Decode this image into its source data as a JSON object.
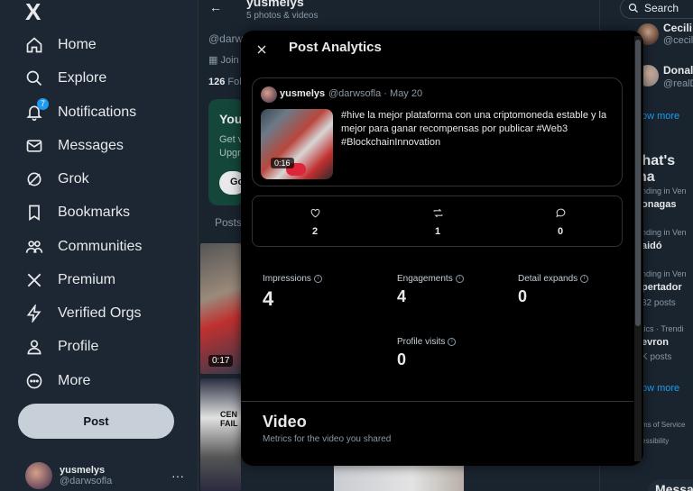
{
  "sidebar": {
    "logo": "X",
    "items": [
      {
        "label": "Home",
        "icon": "home-icon"
      },
      {
        "label": "Explore",
        "icon": "search-icon"
      },
      {
        "label": "Notifications",
        "icon": "bell-icon",
        "badge": "7"
      },
      {
        "label": "Messages",
        "icon": "mail-icon"
      },
      {
        "label": "Grok",
        "icon": "grok-icon"
      },
      {
        "label": "Bookmarks",
        "icon": "bookmark-icon"
      },
      {
        "label": "Communities",
        "icon": "communities-icon"
      },
      {
        "label": "Premium",
        "icon": "x-icon"
      },
      {
        "label": "Verified Orgs",
        "icon": "bolt-icon"
      },
      {
        "label": "Profile",
        "icon": "person-icon"
      },
      {
        "label": "More",
        "icon": "more-circle-icon"
      }
    ],
    "post_button": "Post",
    "account": {
      "name": "yusmelys",
      "handle": "@darwsofla",
      "more": "···"
    }
  },
  "profile": {
    "name": "yusmelys",
    "subtitle": "5 photos & videos",
    "handle_partial": "@darw",
    "joined_partial": "Join",
    "following_count": "126",
    "following_partial": "Fol",
    "premium_title_partial": "You",
    "premium_text_partial": [
      "Get v",
      "Upgr"
    ],
    "premium_button_partial": "Go",
    "posts_tab_partial": "Posts",
    "thumb_duration": "0:17",
    "thumb_caption_partial": [
      "CEN",
      "FAIL"
    ]
  },
  "right": {
    "search_placeholder": "Search",
    "follow_suggestions": [
      {
        "name": "Cecili",
        "handle": "@cecil"
      },
      {
        "name": "Donal",
        "handle": "@realD"
      }
    ],
    "show_more_1": "ow more",
    "heading": "/hat's ha",
    "trends": [
      {
        "context": "nding in Ven",
        "name": "onagas",
        "count": ""
      },
      {
        "context": "nding in Ven",
        "name": "aidó",
        "count": ""
      },
      {
        "context": "nding in Ven",
        "name": "pertador",
        "count": "82 posts"
      },
      {
        "context": "tics · Trendi",
        "name": "evron",
        "count": "K posts"
      }
    ],
    "show_more_2": "ow more",
    "footer": [
      "ms of Service",
      "essibility"
    ],
    "messages": "Messa"
  },
  "modal": {
    "title": "Post Analytics",
    "tweet": {
      "name": "yusmelys",
      "handle": "@darwsofla",
      "date": "May 20",
      "text": "#hive la mejor plataforma con una criptomoneda estable y la mejor para ganar recompensas por publicar #Web3 #BlockchainInnovation",
      "video_duration": "0:16"
    },
    "stats": {
      "likes": "2",
      "reposts": "1",
      "replies": "0"
    },
    "metrics": [
      {
        "label": "Impressions",
        "value": "4"
      },
      {
        "label": "Engagements",
        "value": "4"
      },
      {
        "label": "Detail expands",
        "value": "0"
      },
      {
        "label": "Profile visits",
        "value": "0"
      }
    ],
    "video_section": {
      "title": "Video",
      "subtitle": "Metrics for the video you shared"
    }
  }
}
